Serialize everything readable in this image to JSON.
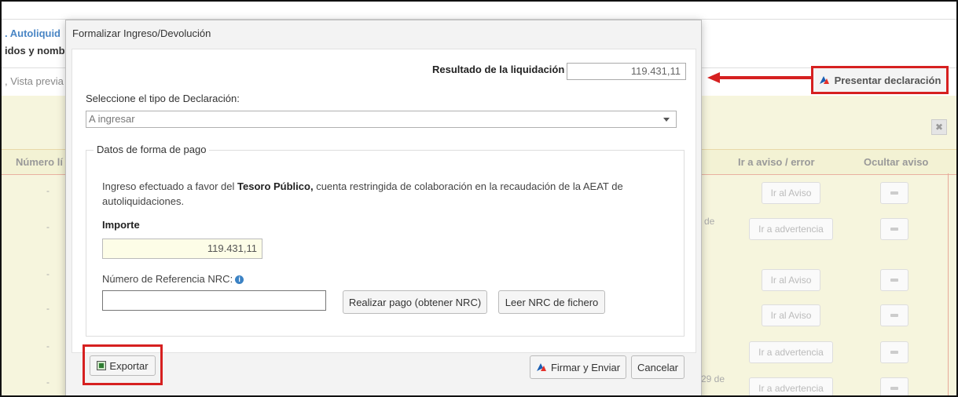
{
  "background": {
    "title": ". Autoliquid",
    "subtitle": "idos y nomb",
    "toolbar": {
      "preview_label": ", Vista previa",
      "present_label": "Presentar declaración"
    },
    "columns": {
      "numero": "Número lí",
      "ir_aviso": "Ir a aviso / error",
      "ocultar": "Ocultar aviso"
    },
    "rows": [
      {
        "dash": "-",
        "action": "Ir al Aviso"
      },
      {
        "dash": "-",
        "action": "Ir a advertencia",
        "fragment": "de"
      },
      {
        "dash": "-",
        "action": "Ir al Aviso"
      },
      {
        "dash": "-",
        "action": "Ir al Aviso"
      },
      {
        "dash": "-",
        "action": "Ir a advertencia"
      },
      {
        "dash": "-",
        "action": "Ir a advertencia",
        "fragment": "29 de"
      }
    ],
    "close_glyph": "✖"
  },
  "modal": {
    "title": "Formalizar Ingreso/Devolución",
    "resultado_label": "Resultado de la liquidación",
    "resultado_value": "119.431,11",
    "tipo_label": "Seleccione el tipo de Declaración:",
    "tipo_selected": "A ingresar",
    "fieldset_legend": "Datos de forma de pago",
    "desc_prefix": "Ingreso efectuado a favor del ",
    "desc_bold": "Tesoro Público,",
    "desc_suffix": " cuenta restringida de colaboración en la recaudación de la AEAT de autoliquidaciones.",
    "importe_label": "Importe",
    "importe_value": "119.431,11",
    "nrc_label": "Número de Referencia  NRC:",
    "nrc_info": "i",
    "nrc_value": "",
    "realizar_pago": "Realizar pago (obtener NRC)",
    "leer_nrc": "Leer NRC de fichero",
    "exportar": "Exportar",
    "firmar": "Firmar y Enviar",
    "cancelar": "Cancelar"
  },
  "colors": {
    "highlight": "#d62020",
    "accent": "#3b82c4",
    "panel": "#f6f5dd"
  },
  "icons": [
    "aeat-logo-icon",
    "arrow-left-icon",
    "info-icon",
    "export-icon",
    "close-icon",
    "eye-slash-icon",
    "chevron-down-icon"
  ]
}
